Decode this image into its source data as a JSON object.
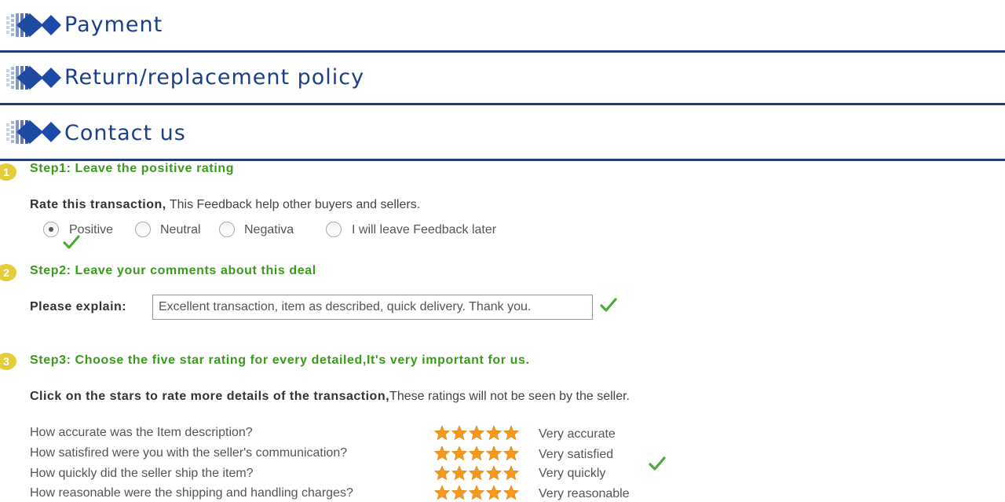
{
  "sections": {
    "payment": "Payment",
    "return_policy": "Return/replacement policy",
    "contact": "Contact us"
  },
  "step1": {
    "badge": "1",
    "title": "Step1: Leave the positive rating",
    "prompt_bold": "Rate this transaction,",
    "prompt_rest": " This Feedback help other buyers and sellers.",
    "options": [
      "Positive",
      "Neutral",
      "Negativa",
      "I will leave Feedback later"
    ],
    "selected": "Positive"
  },
  "step2": {
    "badge": "2",
    "title": "Step2: Leave your comments about this deal",
    "label": "Please explain:",
    "value": "Excellent transaction, item as described, quick delivery. Thank you."
  },
  "step3": {
    "badge": "3",
    "title": "Step3: Choose the five star rating for every detailed,It's very important for us.",
    "prompt_bold": "Click on the stars to rate more details of the transaction,",
    "prompt_rest": "These ratings will not be seen by the seller.",
    "ratings": [
      {
        "question": "How accurate was the Item description?",
        "stars": 5,
        "label": "Very accurate"
      },
      {
        "question": "How satisfired were you with the seller's communication?",
        "stars": 5,
        "label": "Very satisfied"
      },
      {
        "question": "How quickly did the seller ship the item?",
        "stars": 5,
        "label": "Very quickly"
      },
      {
        "question": "How reasonable were the shipping and handling charges?",
        "stars": 5,
        "label": "Very reasonable"
      }
    ]
  },
  "colors": {
    "header_blue": "#1c3f86",
    "step_green": "#3a9a1c",
    "star_orange": "#f39a1e",
    "badge_yellow": "#e3cd3a",
    "check_green": "#4caa3a"
  }
}
